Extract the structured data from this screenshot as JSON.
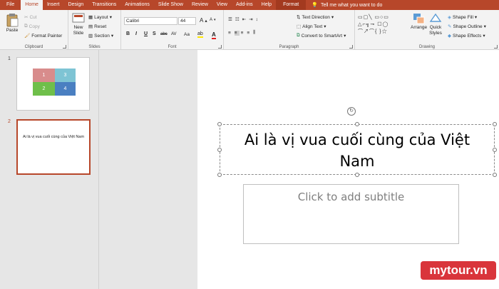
{
  "tabs": [
    {
      "label": "File"
    },
    {
      "label": "Home"
    },
    {
      "label": "Insert"
    },
    {
      "label": "Design"
    },
    {
      "label": "Transitions"
    },
    {
      "label": "Animations"
    },
    {
      "label": "Slide Show"
    },
    {
      "label": "Review"
    },
    {
      "label": "View"
    },
    {
      "label": "Add-ins"
    },
    {
      "label": "Help"
    },
    {
      "label": "Format"
    }
  ],
  "tell_me": "Tell me what you want to do",
  "clipboard": {
    "paste": "Paste",
    "cut": "Cut",
    "copy": "Copy",
    "format_painter": "Format Painter",
    "group": "Clipboard"
  },
  "slides": {
    "new_slide": "New",
    "new_slide2": "Slide",
    "layout": "Layout",
    "reset": "Reset",
    "section": "Section",
    "group": "Slides"
  },
  "font": {
    "name": "Calibri",
    "size": "44",
    "group": "Font",
    "bold": "B",
    "italic": "I",
    "underline": "U",
    "shadow": "S",
    "strike": "abc",
    "spacing": "AV",
    "case": "Aa",
    "clear": "A",
    "grow": "A",
    "shrink": "A",
    "color": "A"
  },
  "paragraph": {
    "text_direction": "Text Direction",
    "align_text": "Align Text",
    "convert": "Convert to SmartArt",
    "group": "Paragraph"
  },
  "drawing": {
    "arrange": "Arrange",
    "quick_styles_1": "Quick",
    "quick_styles_2": "Styles",
    "shape_fill": "Shape Fill",
    "shape_outline": "Shape Outline",
    "shape_effects": "Shape Effects",
    "group": "Drawing",
    "shapes_row1": "▭▢╲ ▭○▭",
    "shapes_row2": "△⌐╗⊸ ☐◯",
    "shapes_row3": "⌒↗⌒{ }☆"
  },
  "thumbnails": [
    {
      "number": "1",
      "cells": [
        "1",
        "3",
        "2",
        "4"
      ],
      "colors": [
        "#d88c8c",
        "#7ec4d4",
        "#6fbf4a",
        "#4a7fc1"
      ]
    },
    {
      "number": "2",
      "title": "Ai là vị vua cuối cùng của Việt Nam"
    }
  ],
  "slide": {
    "title_line1": "Ai là vị vua cuối cùng của Việt",
    "title_line2": "Nam",
    "subtitle_placeholder": "Click to add subtitle"
  },
  "watermark": "mytour.vn"
}
